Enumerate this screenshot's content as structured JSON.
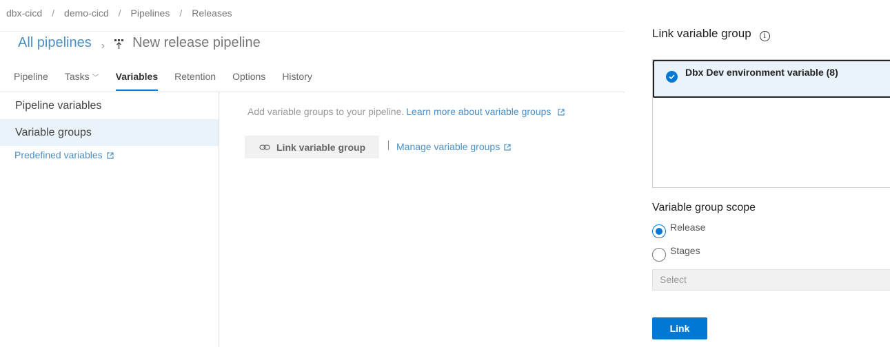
{
  "breadcrumb": [
    "dbx-cicd",
    "demo-cicd",
    "Pipelines",
    "Releases"
  ],
  "header": {
    "all_pipelines": "All pipelines",
    "pipeline_title": "New release pipeline"
  },
  "tabs": [
    {
      "label": "Pipeline"
    },
    {
      "label": "Tasks"
    },
    {
      "label": "Variables"
    },
    {
      "label": "Retention"
    },
    {
      "label": "Options"
    },
    {
      "label": "History"
    }
  ],
  "active_tab": "Variables",
  "leftnav": {
    "items": [
      {
        "label": "Pipeline variables"
      },
      {
        "label": "Variable groups"
      }
    ],
    "selected": "Variable groups",
    "predefined_link": "Predefined variables"
  },
  "main": {
    "hint": "Add variable groups to your pipeline.",
    "learn_more": "Learn more about variable groups",
    "link_button": "Link variable group",
    "manage_link": "Manage variable groups"
  },
  "panel": {
    "title": "Link variable group",
    "groups": [
      {
        "name": "Dbx Dev environment variable (8)",
        "selected": true
      }
    ],
    "scope_title": "Variable group scope",
    "scope_options": [
      {
        "label": "Release",
        "checked": true
      },
      {
        "label": "Stages",
        "checked": false
      }
    ],
    "stages_placeholder": "Select",
    "link_button": "Link"
  },
  "colors": {
    "accent": "#0078d4",
    "link": "#4a8fc8",
    "selected_bg": "#eaf2fa"
  }
}
